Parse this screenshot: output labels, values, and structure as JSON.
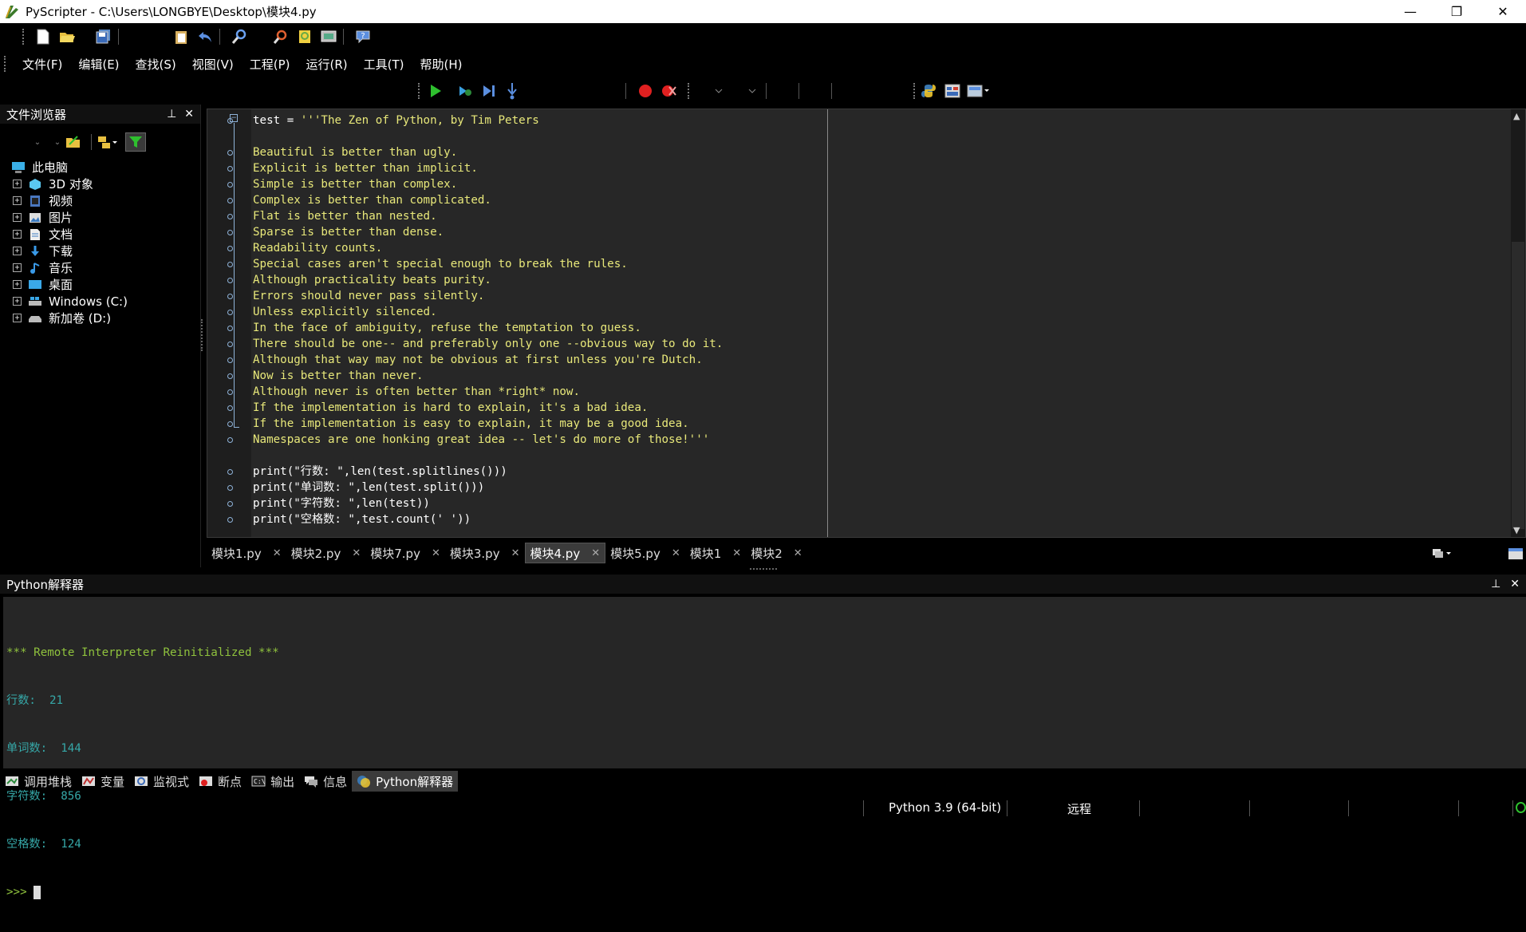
{
  "window": {
    "title": "PyScripter - C:\\Users\\LONGBYE\\Desktop\\模块4.py",
    "minimize": "—",
    "restore": "❐",
    "close": "✕"
  },
  "menu": [
    "文件(F)",
    "编辑(E)",
    "查找(S)",
    "视图(V)",
    "工程(P)",
    "运行(R)",
    "工具(T)",
    "帮助(H)"
  ],
  "file_browser": {
    "title": "文件浏览器",
    "root": "此电脑",
    "items": [
      "3D 对象",
      "视频",
      "图片",
      "文档",
      "下载",
      "音乐",
      "桌面",
      "Windows (C:)",
      "新加卷 (D:)"
    ]
  },
  "editor": {
    "lines": [
      {
        "a": "test = ",
        "s": "'''The Zen of Python, by Tim Peters"
      },
      {
        "a": "",
        "s": ""
      },
      {
        "a": "",
        "s": "Beautiful is better than ugly."
      },
      {
        "a": "",
        "s": "Explicit is better than implicit."
      },
      {
        "a": "",
        "s": "Simple is better than complex."
      },
      {
        "a": "",
        "s": "Complex is better than complicated."
      },
      {
        "a": "",
        "s": "Flat is better than nested."
      },
      {
        "a": "",
        "s": "Sparse is better than dense."
      },
      {
        "a": "",
        "s": "Readability counts."
      },
      {
        "a": "",
        "s": "Special cases aren't special enough to break the rules."
      },
      {
        "a": "",
        "s": "Although practicality beats purity."
      },
      {
        "a": "",
        "s": "Errors should never pass silently."
      },
      {
        "a": "",
        "s": "Unless explicitly silenced."
      },
      {
        "a": "",
        "s": "In the face of ambiguity, refuse the temptation to guess."
      },
      {
        "a": "",
        "s": "There should be one-- and preferably only one --obvious way to do it."
      },
      {
        "a": "",
        "s": "Although that way may not be obvious at first unless you're Dutch."
      },
      {
        "a": "",
        "s": "Now is better than never."
      },
      {
        "a": "",
        "s": "Although never is often better than *right* now."
      },
      {
        "a": "",
        "s": "If the implementation is hard to explain, it's a bad idea."
      },
      {
        "a": "",
        "s": "If the implementation is easy to explain, it may be a good idea."
      },
      {
        "a": "",
        "s": "Namespaces are one honking great idea -- let's do more of those!'''"
      },
      {
        "a": "",
        "s": ""
      },
      {
        "a": "print(\"行数: \",len(test.splitlines()))",
        "s": ""
      },
      {
        "a": "print(\"单词数: \",len(test.split()))",
        "s": ""
      },
      {
        "a": "print(\"字符数: \",len(test))",
        "s": ""
      },
      {
        "a": "print(\"空格数: \",test.count(' '))",
        "s": ""
      }
    ]
  },
  "tabs": [
    {
      "label": "模块1.py",
      "active": false
    },
    {
      "label": "模块2.py",
      "active": false
    },
    {
      "label": "模块7.py",
      "active": false
    },
    {
      "label": "模块3.py",
      "active": false
    },
    {
      "label": "模块4.py",
      "active": true
    },
    {
      "label": "模块5.py",
      "active": false
    },
    {
      "label": "模块1",
      "active": false
    },
    {
      "label": "模块2",
      "active": false
    }
  ],
  "interpreter": {
    "title": "Python解释器",
    "reinit": "*** Remote Interpreter Reinitialized ***",
    "outputs": [
      {
        "label": "行数: ",
        "value": "21"
      },
      {
        "label": "单词数: ",
        "value": "144"
      },
      {
        "label": "字符数: ",
        "value": "856"
      },
      {
        "label": "空格数: ",
        "value": "124"
      }
    ],
    "prompt": ">>> "
  },
  "bottom_tabs": [
    "调用堆栈",
    "变量",
    "监视式",
    "断点",
    "输出",
    "信息",
    "Python解释器"
  ],
  "status": {
    "python_version": "Python 3.9 (64-bit)",
    "mode": "远程"
  }
}
